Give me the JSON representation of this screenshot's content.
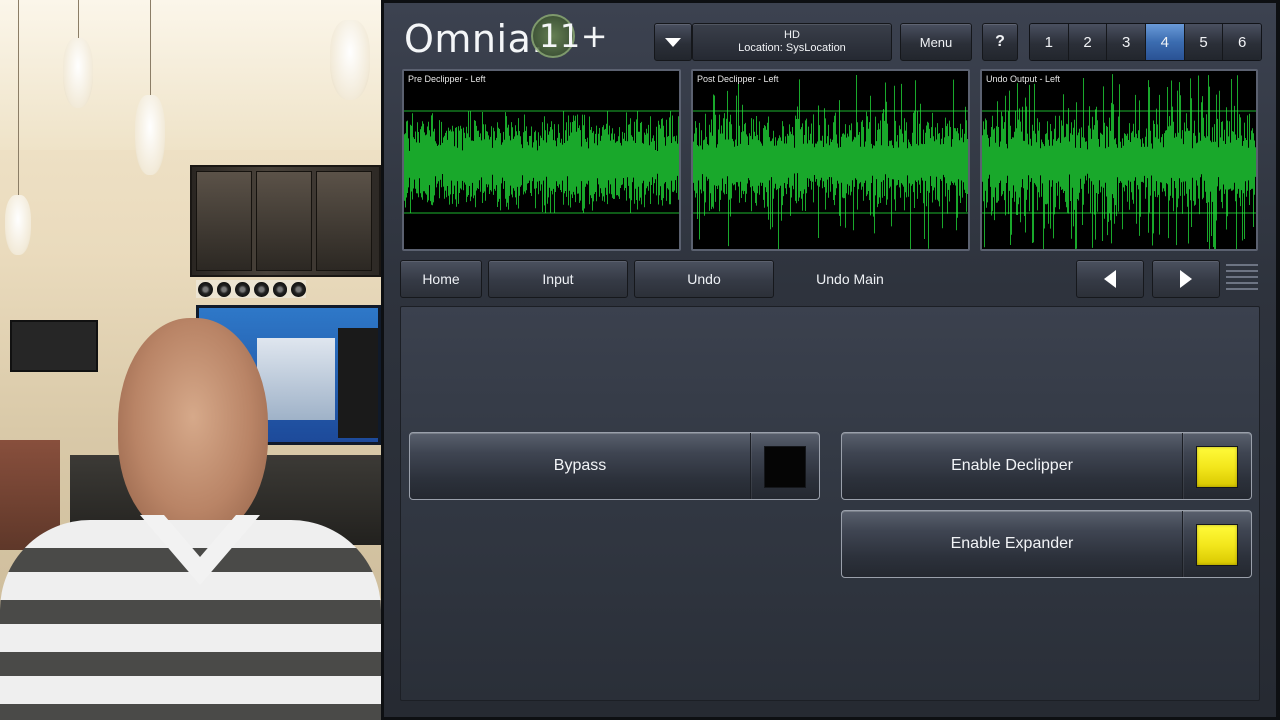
{
  "header": {
    "logo_text": "Omnia.",
    "logo_suffix": "11+",
    "preset_line1": "HD",
    "preset_line2": "Location: SysLocation",
    "menu_label": "Menu",
    "help_label": "?",
    "number_buttons": [
      "1",
      "2",
      "3",
      "4",
      "5",
      "6"
    ],
    "active_number": "4"
  },
  "scopes": [
    {
      "title": "Pre Declipper - Left"
    },
    {
      "title": "Post Declipper - Left"
    },
    {
      "title": "Undo Output - Left"
    }
  ],
  "nav": {
    "home": "Home",
    "input": "Input",
    "undo": "Undo",
    "undo_main": "Undo Main"
  },
  "toggles": {
    "bypass": {
      "label": "Bypass",
      "state": "off"
    },
    "declipper": {
      "label": "Enable Declipper",
      "state": "on"
    },
    "expander": {
      "label": "Enable Expander",
      "state": "on"
    }
  },
  "colors": {
    "scope_trace": "#22e03a",
    "active_tab": "#3b6cb0",
    "led_on": "#f3e71c",
    "led_off": "#050505"
  }
}
